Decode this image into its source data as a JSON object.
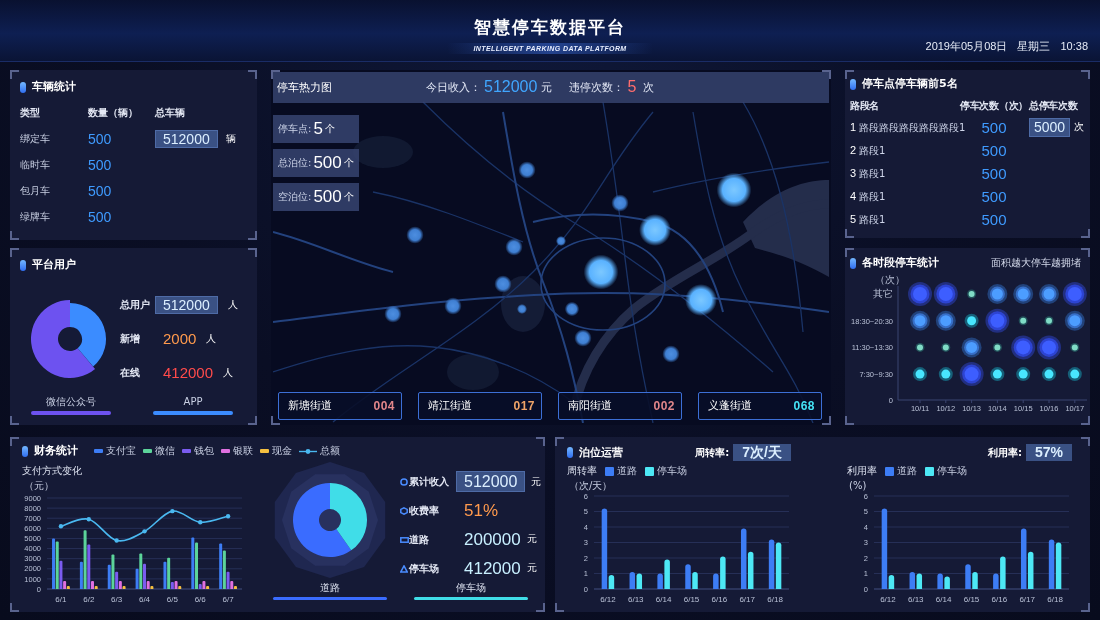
{
  "header": {
    "title": "智慧停车数据平台",
    "subtitle": "INTELLIGENT PARKING DATA PLATFORM",
    "date": "2019年05月08日",
    "weekday": "星期三",
    "time": "10:38"
  },
  "vehicle_stats": {
    "title": "车辆统计",
    "columns": [
      "类型",
      "数量（辆）",
      "总车辆"
    ],
    "rows": [
      {
        "type": "绑定车",
        "count": "500"
      },
      {
        "type": "临时车",
        "count": "500"
      },
      {
        "type": "包月车",
        "count": "500"
      },
      {
        "type": "绿牌车",
        "count": "500"
      }
    ],
    "total": "512000",
    "total_unit": "辆"
  },
  "platform_users": {
    "title": "平台用户",
    "stats": [
      {
        "label": "总用户",
        "value": "512000",
        "unit": "人",
        "kind": "boxed"
      },
      {
        "label": "新增",
        "value": "2000",
        "unit": "人",
        "kind": "plain",
        "color": "#ff9a4d"
      },
      {
        "label": "在线",
        "value": "412000",
        "unit": "人",
        "kind": "plain",
        "color": "#ff4b4b"
      }
    ],
    "legend": [
      {
        "label": "微信公众号",
        "color": "#6d52f0"
      },
      {
        "label": "APP",
        "color": "#3b8cff"
      }
    ]
  },
  "heatmap": {
    "title": "停车热力图",
    "income_label": "今日收入：",
    "income": "512000",
    "income_unit": "元",
    "violation_label": "违停次数：",
    "violations": "5",
    "violation_unit": "次",
    "stats": [
      {
        "label": "停车点:",
        "value": "5",
        "unit": "个"
      },
      {
        "label": "总泊位:",
        "value": "500",
        "unit": "个"
      },
      {
        "label": "空泊位:",
        "value": "500",
        "unit": "个"
      }
    ],
    "streets": [
      {
        "name": "新塘街道",
        "code": "004",
        "color": "#e0868a"
      },
      {
        "name": "靖江街道",
        "code": "017",
        "color": "#f0a468"
      },
      {
        "name": "南阳街道",
        "code": "002",
        "color": "#e0868a"
      },
      {
        "name": "义蓬街道",
        "code": "068",
        "color": "#45e3f5"
      }
    ]
  },
  "ranking": {
    "title": "停车点停车辆前5名",
    "columns": [
      "路段名",
      "停车次数（次）",
      "总停车次数"
    ],
    "rows": [
      {
        "rank": "1",
        "name": "路段路段路段路段路段1",
        "count": "500"
      },
      {
        "rank": "2",
        "name": "路段1",
        "count": "500"
      },
      {
        "rank": "3",
        "name": "路段1",
        "count": "500"
      },
      {
        "rank": "4",
        "name": "路段1",
        "count": "500"
      },
      {
        "rank": "5",
        "name": "路段1",
        "count": "500"
      }
    ],
    "total": "5000",
    "total_unit": "次"
  },
  "period_stats": {
    "title": "各时段停车统计",
    "note": "面积越大停车越拥堵",
    "y_unit": "（次）",
    "rows": [
      "其它",
      "18:30~20:30",
      "11:30~13:30",
      "7:30~9:30"
    ],
    "zero": "0",
    "columns": [
      "10/11",
      "10/12",
      "10/13",
      "10/14",
      "10/15",
      "10/16",
      "10/17"
    ]
  },
  "finance": {
    "title": "财务统计",
    "chart_data": {
      "type": "bar",
      "title": "支付方式变化",
      "ylabel": "（元）",
      "categories": [
        "6/1",
        "6/2",
        "6/3",
        "6/4",
        "6/5",
        "6/6",
        "6/7"
      ],
      "ylim": [
        0,
        9000
      ],
      "yticks": [
        0,
        1000,
        2000,
        3000,
        4000,
        5000,
        6000,
        7000,
        8000,
        9000
      ],
      "grid": true,
      "series": [
        {
          "name": "支付宝",
          "color": "#3d7df5",
          "values": [
            5000,
            2700,
            2400,
            2000,
            2700,
            5100,
            4500
          ]
        },
        {
          "name": "微信",
          "color": "#5cd49a",
          "values": [
            4700,
            5800,
            3400,
            3500,
            3100,
            4600,
            3800
          ]
        },
        {
          "name": "钱包",
          "color": "#7a5cf0",
          "values": [
            2800,
            4400,
            1700,
            2500,
            700,
            500,
            1700
          ]
        },
        {
          "name": "银联",
          "color": "#e070e0",
          "values": [
            800,
            800,
            800,
            800,
            800,
            800,
            800
          ]
        },
        {
          "name": "现金",
          "color": "#f5c040",
          "values": [
            300,
            300,
            300,
            300,
            300,
            300,
            300
          ]
        },
        {
          "name": "总额",
          "color": "#4ab8f0",
          "type": "line",
          "values": [
            6200,
            6900,
            4800,
            5700,
            7700,
            6600,
            7200
          ]
        }
      ]
    },
    "donut_legend": [
      {
        "label": "道路",
        "color": "#3a6cff"
      },
      {
        "label": "停车场",
        "color": "#40dde8"
      }
    ],
    "stats": [
      {
        "label": "累计收入",
        "value": "512000",
        "unit": "元",
        "kind": "boxed"
      },
      {
        "label": "收费率",
        "value": "51%",
        "kind": "plain",
        "color": "#ff9a4d"
      },
      {
        "label": "道路",
        "value": "200000",
        "unit": "元",
        "kind": "plain",
        "color": "#c8f0ff"
      },
      {
        "label": "停车场",
        "value": "412000",
        "unit": "元",
        "kind": "plain",
        "color": "#c8f0ff"
      }
    ]
  },
  "operations": {
    "title": "泊位运营",
    "rates": [
      {
        "label": "周转率:",
        "value": "7次/天"
      },
      {
        "label": "利用率:",
        "value": "57%"
      }
    ],
    "charts": [
      {
        "chart_data": {
          "type": "bar",
          "title": "周转率",
          "ylabel": "（次/天）",
          "categories": [
            "6/12",
            "6/13",
            "6/14",
            "6/15",
            "6/16",
            "6/17",
            "6/18"
          ],
          "ylim": [
            0,
            6
          ],
          "yticks": [
            0,
            1,
            2,
            3,
            4,
            5,
            6
          ],
          "grid": true,
          "series": [
            {
              "name": "道路",
              "color": "#3d7df5",
              "values": [
                5.2,
                1.1,
                1.0,
                1.6,
                1.0,
                3.9,
                3.2
              ]
            },
            {
              "name": "停车场",
              "color": "#4de8f5",
              "values": [
                0.9,
                1.0,
                1.9,
                1.1,
                2.1,
                2.4,
                3.0
              ]
            }
          ]
        }
      },
      {
        "chart_data": {
          "type": "bar",
          "title": "利用率",
          "ylabel": "(%)",
          "categories": [
            "6/12",
            "6/13",
            "6/14",
            "6/15",
            "6/16",
            "6/17",
            "6/18"
          ],
          "ylim": [
            0,
            6
          ],
          "yticks": [
            0,
            1,
            2,
            3,
            4,
            5,
            6
          ],
          "grid": true,
          "series": [
            {
              "name": "道路",
              "color": "#3d7df5",
              "values": [
                5.2,
                1.1,
                1.0,
                1.6,
                1.0,
                3.9,
                3.2
              ]
            },
            {
              "name": "停车场",
              "color": "#4de8f5",
              "values": [
                0.9,
                1.0,
                0.8,
                1.1,
                2.1,
                2.4,
                3.0
              ]
            }
          ]
        }
      }
    ]
  }
}
